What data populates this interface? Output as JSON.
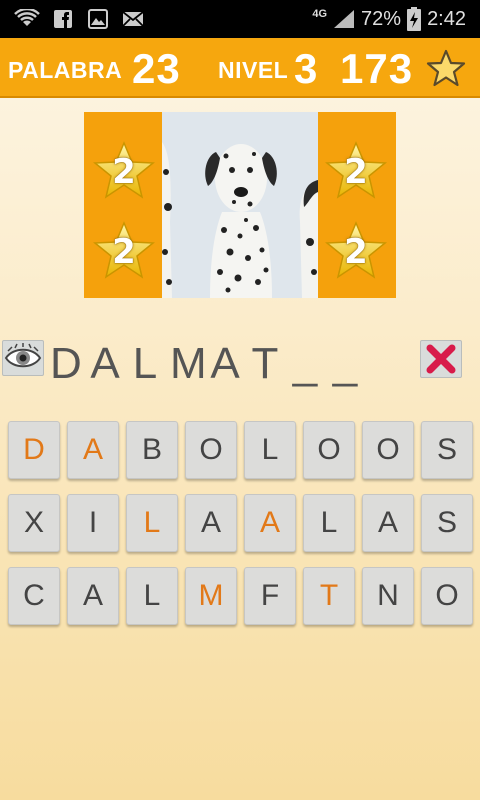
{
  "status_bar": {
    "network": "4G",
    "battery": "72%",
    "time": "2:42"
  },
  "header": {
    "word_label": "PALABRA",
    "word_number": "23",
    "level_label": "NIVEL",
    "level_number": "3",
    "coins": "173"
  },
  "picture": {
    "reward_value": "2"
  },
  "answer": {
    "slots": [
      "D",
      "A",
      "L",
      "M",
      "A",
      "T",
      "_",
      "_"
    ]
  },
  "letters": [
    {
      "char": "D",
      "used": true
    },
    {
      "char": "A",
      "used": true
    },
    {
      "char": "B",
      "used": false
    },
    {
      "char": "O",
      "used": false
    },
    {
      "char": "L",
      "used": false
    },
    {
      "char": "O",
      "used": false
    },
    {
      "char": "O",
      "used": false
    },
    {
      "char": "S",
      "used": false
    },
    {
      "char": "X",
      "used": false
    },
    {
      "char": "I",
      "used": false
    },
    {
      "char": "L",
      "used": true
    },
    {
      "char": "A",
      "used": false
    },
    {
      "char": "A",
      "used": true
    },
    {
      "char": "L",
      "used": false
    },
    {
      "char": "A",
      "used": false
    },
    {
      "char": "S",
      "used": false
    },
    {
      "char": "C",
      "used": false
    },
    {
      "char": "A",
      "used": false
    },
    {
      "char": "L",
      "used": false
    },
    {
      "char": "M",
      "used": true
    },
    {
      "char": "F",
      "used": false
    },
    {
      "char": "T",
      "used": true
    },
    {
      "char": "N",
      "used": false
    },
    {
      "char": "O",
      "used": false
    }
  ],
  "colors": {
    "accent": "#f6a70e",
    "used_letter": "#e27918",
    "delete": "#d81b4a"
  },
  "icons": {
    "hint": "eye-icon",
    "delete": "x-icon",
    "coins": "star-icon"
  }
}
